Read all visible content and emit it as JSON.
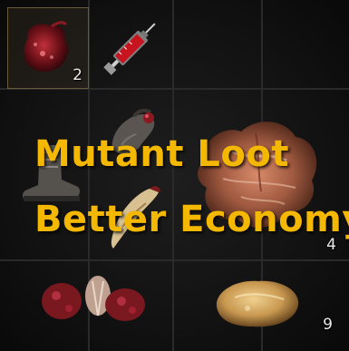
{
  "overlay": {
    "title_line_1": "Mutant Loot",
    "title_line_2": "Better Economy",
    "color": "#f5b800"
  },
  "inventory": {
    "slots": [
      {
        "item": "flesh-chunk-icon",
        "count": "2",
        "selected": true
      },
      {
        "item": "syringe-icon",
        "count": ""
      },
      {
        "item": "mutant-hand-icon",
        "count": ""
      },
      {
        "item": "mutant-skin-icon",
        "count": "4"
      },
      {
        "item": "boot-icon",
        "count": ""
      },
      {
        "item": "claw-icon",
        "count": ""
      },
      {
        "item": "organ-cluster-icon",
        "count": ""
      },
      {
        "item": "fat-chunk-icon",
        "count": "9"
      }
    ]
  },
  "colors": {
    "background": "#121212",
    "grid_line": "#2a2a2a",
    "selected_border": "#6b5a3a",
    "count_text": "#eaeaea"
  }
}
